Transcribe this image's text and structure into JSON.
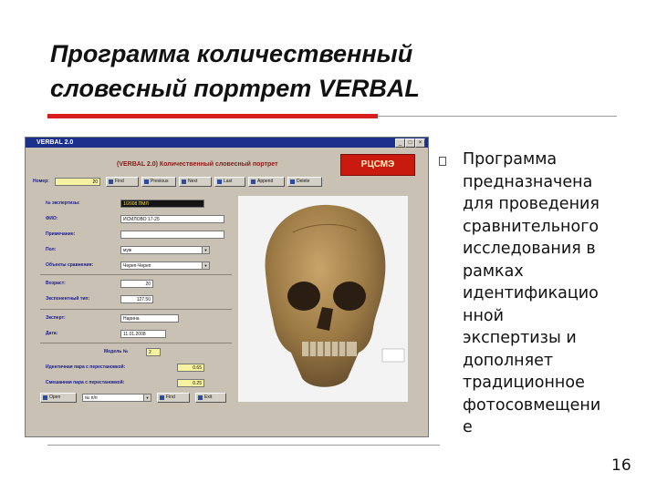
{
  "slide": {
    "title_line1": "Программа количественный",
    "title_line2": "словесный портрет VERBAL",
    "body": "Программа\nпредназначена\nдля проведения\nсравнительного\nисследования в\nрамках\nидентификацио\nнной\nэкспертизы и\nдополняет\nтрадиционное\nфотосовмещени\nе",
    "page_number": "16"
  },
  "screenshot": {
    "window_title": "VERBAL 2.0",
    "header": "(VERBAL 2.0)   Количественный словесный портрет",
    "logo": "РЦСМЭ",
    "nav": {
      "record_label": "Номер:",
      "record_value": "20",
      "buttons": [
        "Find",
        "Previous",
        "Next",
        "Last",
        "Append",
        "Delete"
      ]
    },
    "form": {
      "fields": [
        {
          "label": "№ экспертизы:",
          "value": "1/2008 ПМЛ"
        },
        {
          "label": "ФИО:",
          "value": "ИСМЛОВО 17-25"
        },
        {
          "label": "Примечание:",
          "value": ""
        },
        {
          "label": "Пол:",
          "value": "муж"
        },
        {
          "label": "Объекты сравнения:",
          "value": "Череп-Череп"
        },
        {
          "label": "Возраст:",
          "value": "20"
        },
        {
          "label": "Экспонентный тип:",
          "value": "127.50"
        },
        {
          "label": "Эксперт:",
          "value": "Нарина"
        },
        {
          "label": "Дата:",
          "value": "11.01.2008"
        },
        {
          "label": "Модель №",
          "value": "2"
        },
        {
          "label": "Идентичная пара с перестановкой:",
          "value": "0.65"
        },
        {
          "label": "Смешанная пара с перестановкой:",
          "value": "0.25"
        }
      ],
      "bottom": {
        "open": "Open",
        "selector": "№ п/п",
        "find": "Find",
        "exit": "Exit"
      }
    },
    "photo_alt": "skull-photo"
  }
}
